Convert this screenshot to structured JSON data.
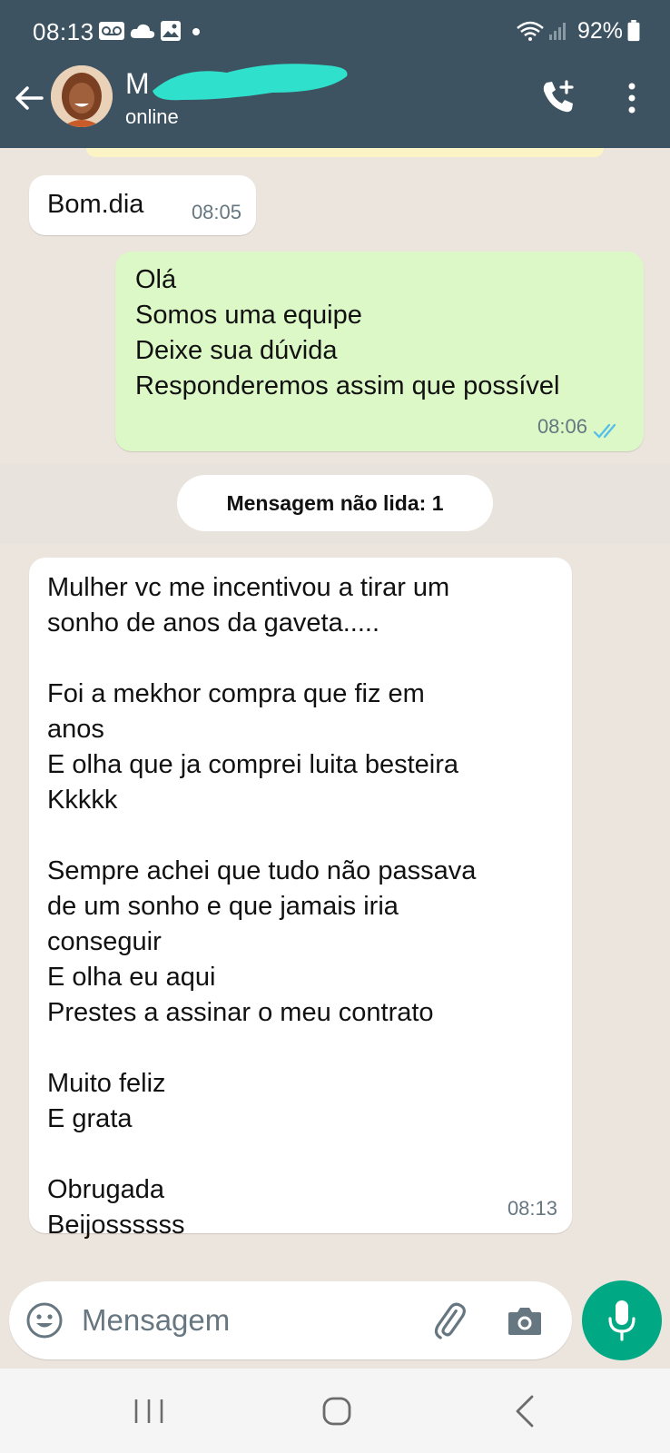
{
  "status_bar": {
    "time": "08:13",
    "battery": "92%",
    "left_icons": [
      "voicemail-icon",
      "cloud-icon",
      "image-icon",
      "dot-icon"
    ],
    "right_icons": [
      "wifi-icon",
      "signal-icon",
      "battery-icon"
    ]
  },
  "header": {
    "contact_name": "M",
    "contact_status": "online",
    "name_redacted": true,
    "background_color": "#3d5361"
  },
  "messages": [
    {
      "direction": "incoming",
      "lines": [
        "Bom.dia"
      ],
      "time": "08:05"
    },
    {
      "direction": "outgoing",
      "lines": [
        "Olá",
        "Somos uma equipe",
        "Deixe sua dúvida",
        "Responderemos assim que possível"
      ],
      "time": "08:06",
      "status": "read"
    },
    {
      "direction": "incoming",
      "lines": [
        "Mulher vc me incentivou a tirar um",
        "sonho de anos da gaveta.....",
        "",
        "Foi a mekhor compra que fiz em",
        "anos",
        "E olha que ja comprei luita besteira",
        "Kkkkk",
        "",
        "Sempre achei que tudo não passava",
        "de um sonho e que jamais iria",
        "conseguir",
        "E olha eu aqui",
        "Prestes a assinar o meu contrato",
        "",
        "Muito feliz",
        "E grata",
        "",
        "Obrugada",
        "Beijossssss"
      ],
      "time": "08:13"
    }
  ],
  "unread_divider": "Mensagem não lida: 1",
  "composer": {
    "placeholder": "Mensagem"
  },
  "colors": {
    "incoming_bubble": "#ffffff",
    "outgoing_bubble": "#dcf8c6",
    "chat_background": "#ece5dd",
    "mic_button": "#00a884",
    "read_ticks": "#53bdeb"
  }
}
